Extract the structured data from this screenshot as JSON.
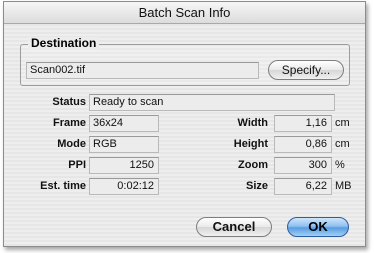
{
  "window": {
    "title": "Batch Scan Info"
  },
  "destination": {
    "label": "Destination",
    "filename": "Scan002.tif",
    "specify_label": "Specify..."
  },
  "fields": {
    "status": {
      "label": "Status",
      "value": "Ready to scan"
    },
    "frame": {
      "label": "Frame",
      "value": "36x24"
    },
    "mode": {
      "label": "Mode",
      "value": "RGB"
    },
    "ppi": {
      "label": "PPI",
      "value": "1250"
    },
    "est_time": {
      "label": "Est. time",
      "value": "0:02:12"
    },
    "width": {
      "label": "Width",
      "value": "1,16",
      "unit": "cm"
    },
    "height": {
      "label": "Height",
      "value": "0,86",
      "unit": "cm"
    },
    "zoom": {
      "label": "Zoom",
      "value": "300",
      "unit": "%"
    },
    "size": {
      "label": "Size",
      "value": "6,22",
      "unit": "MB"
    }
  },
  "buttons": {
    "cancel": "Cancel",
    "ok": "OK"
  }
}
